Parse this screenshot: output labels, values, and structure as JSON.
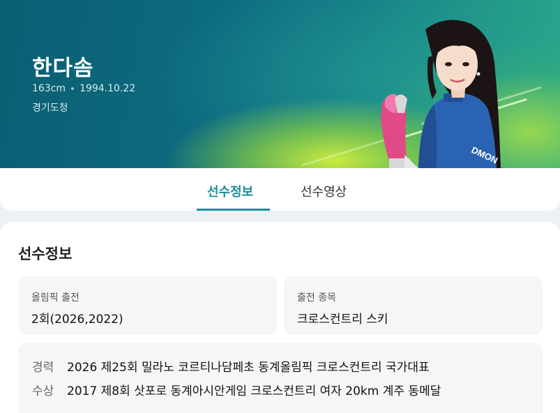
{
  "athlete": {
    "name": "한다솜",
    "height": "163cm",
    "birthdate": "1994.10.22",
    "team": "경기도청"
  },
  "tabs": [
    {
      "label": "선수정보",
      "active": true
    },
    {
      "label": "선수영상",
      "active": false
    }
  ],
  "section": {
    "title": "선수정보",
    "cards": [
      {
        "label": "올림픽 출전",
        "value": "2회(2026,2022)"
      },
      {
        "label": "출전 종목",
        "value": "크로스컨트리 스키"
      }
    ],
    "history": [
      {
        "key": "경력",
        "value": "2026 제25회 밀라노 코르티나담페초 동계올림픽 크로스컨트리 국가대표"
      },
      {
        "key": "수상",
        "value": "2017 제8회 삿포로 동계아시안게임 크로스컨트리 여자 20km 계주 동메달"
      }
    ]
  },
  "colors": {
    "accent": "#1a8f99",
    "hero_dark": "#0a5e72",
    "hero_light": "#c8e84a"
  },
  "jersey_text": "DMON"
}
